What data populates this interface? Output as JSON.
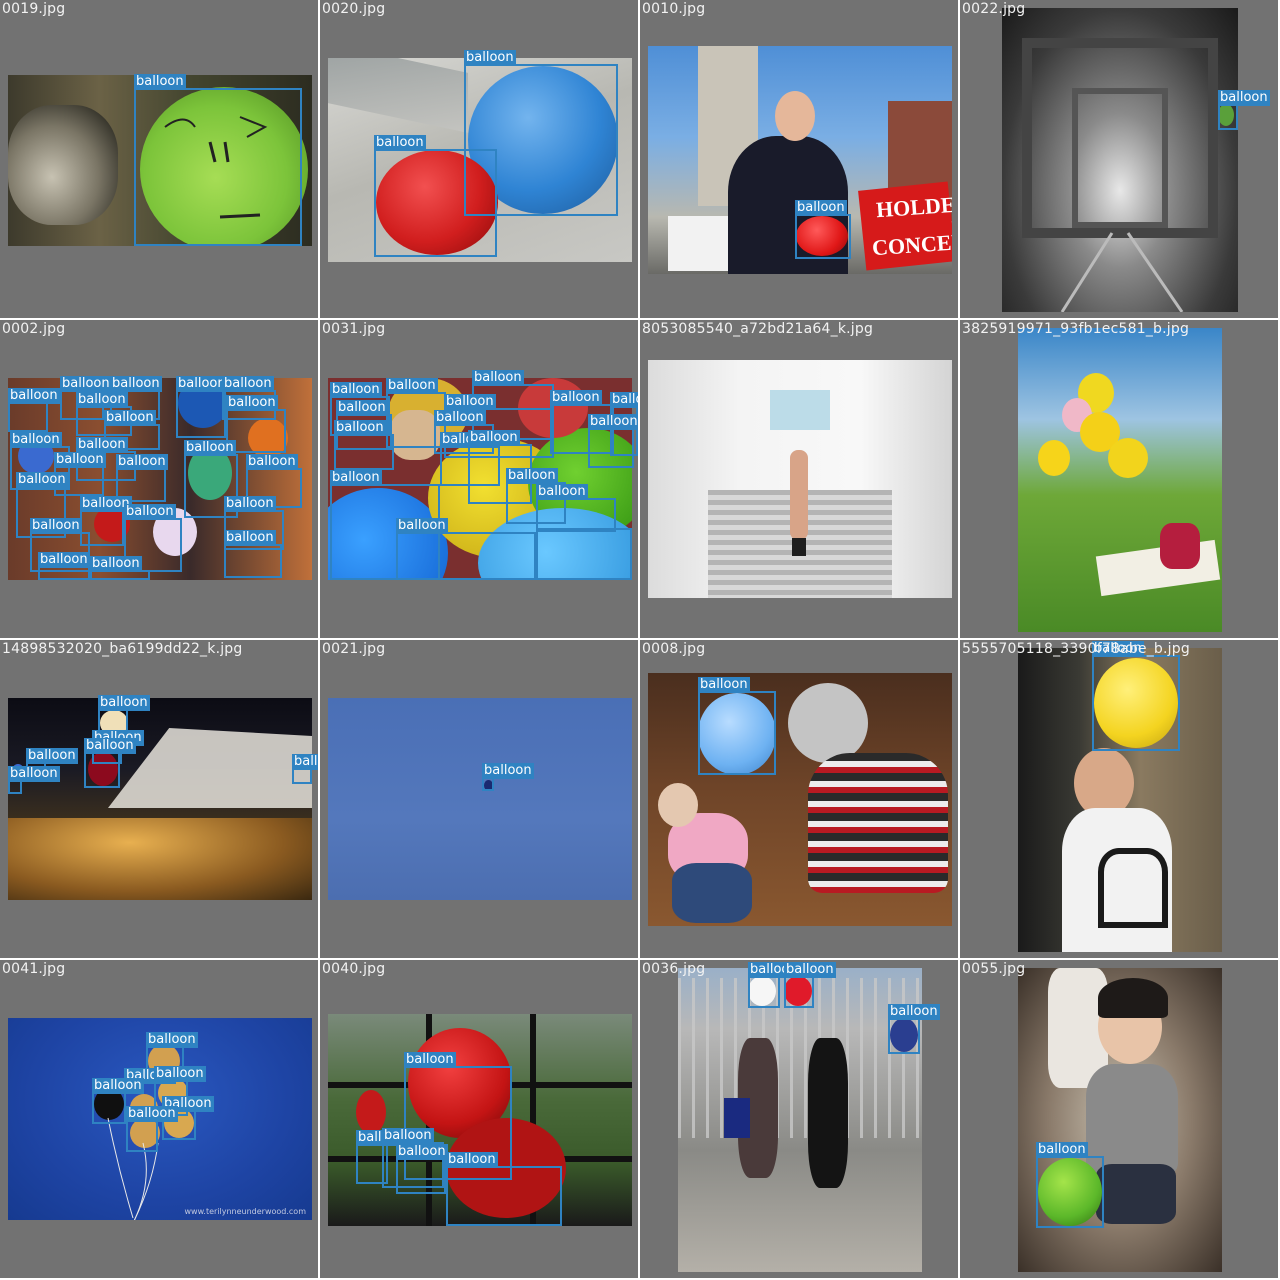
{
  "grid": {
    "tiles": [
      {
        "filename": "0019.jpg"
      },
      {
        "filename": "0020.jpg"
      },
      {
        "filename": "0010.jpg",
        "banner_line1": "HOLDEN",
        "banner_line2": "CONCER"
      },
      {
        "filename": "0022.jpg"
      },
      {
        "filename": "0002.jpg"
      },
      {
        "filename": "0031.jpg"
      },
      {
        "filename": "8053085540_a72bd21a64_k.jpg"
      },
      {
        "filename": "3825919971_93fb1ec581_b.jpg"
      },
      {
        "filename": "14898532020_ba6199dd22_k.jpg"
      },
      {
        "filename": "0021.jpg"
      },
      {
        "filename": "0008.jpg"
      },
      {
        "filename": "5555705118_3390f78abe_b.jpg"
      },
      {
        "filename": "0041.jpg",
        "watermark": "www.terilynneunderwood.com"
      },
      {
        "filename": "0040.jpg"
      },
      {
        "filename": "0036.jpg"
      },
      {
        "filename": "0055.jpg"
      }
    ]
  },
  "detection": {
    "class_label": "balloon",
    "box_color": "#2f83c2",
    "tile_background": "#727272",
    "label_text_color": "#ffffff"
  }
}
